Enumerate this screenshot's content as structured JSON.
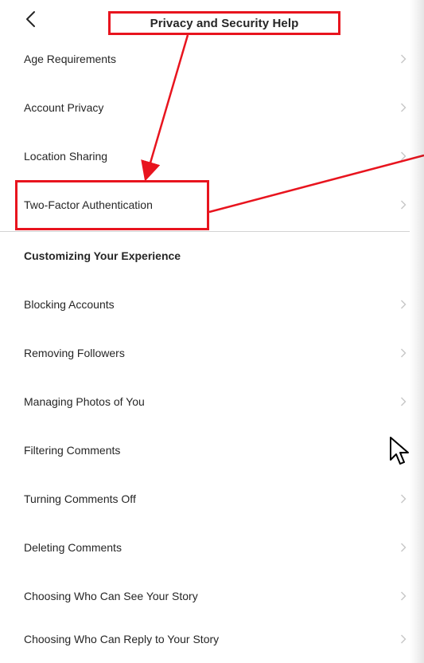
{
  "header": {
    "title": "Privacy and Security Help",
    "back_icon": "chevron-left-icon"
  },
  "rows": [
    {
      "label": "Age Requirements"
    },
    {
      "label": "Account Privacy"
    },
    {
      "label": "Location Sharing"
    },
    {
      "label": "Two-Factor Authentication"
    }
  ],
  "section": {
    "title": "Customizing Your Experience",
    "items": [
      {
        "label": "Blocking Accounts"
      },
      {
        "label": "Removing Followers"
      },
      {
        "label": "Managing Photos of You"
      },
      {
        "label": "Filtering Comments"
      },
      {
        "label": "Turning Comments Off"
      },
      {
        "label": "Deleting Comments"
      },
      {
        "label": "Choosing Who Can See Your Story"
      },
      {
        "label": "Choosing Who Can Reply to Your Story"
      }
    ]
  },
  "colors": {
    "annotation": "#e8141e",
    "text": "#262626",
    "chevron": "#c7c7c7",
    "divider": "#d4d4d4"
  },
  "icons": {
    "row_chevron": "chevron-right-icon",
    "cursor": "mouse-pointer-icon"
  }
}
